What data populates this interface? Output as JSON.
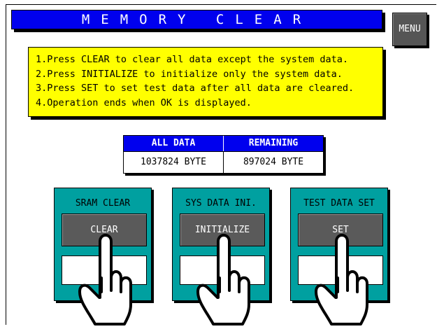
{
  "title": "MEMORY CLEAR",
  "menu_label": "MENU",
  "instructions": [
    "1.Press CLEAR to clear all data except the system data.",
    "2.Press INITIALIZE to initialize only the system data.",
    "3.Press SET to set test data after all data are cleared.",
    "4.Operation ends when OK is displayed."
  ],
  "memory_table": {
    "headers": [
      "ALL DATA",
      "REMAINING"
    ],
    "values": [
      "1037824 BYTE",
      "897024 BYTE"
    ]
  },
  "panels": [
    {
      "title": "SRAM CLEAR",
      "button": "CLEAR"
    },
    {
      "title": "SYS DATA INI.",
      "button": "INITIALIZE"
    },
    {
      "title": "TEST DATA SET",
      "button": "SET"
    }
  ],
  "colors": {
    "title_bar": "#0000ee",
    "info_box": "#ffff00",
    "panel": "#00a0a0",
    "button": "#5a5a5a"
  },
  "icons": [
    "pointing-hand-icon"
  ]
}
